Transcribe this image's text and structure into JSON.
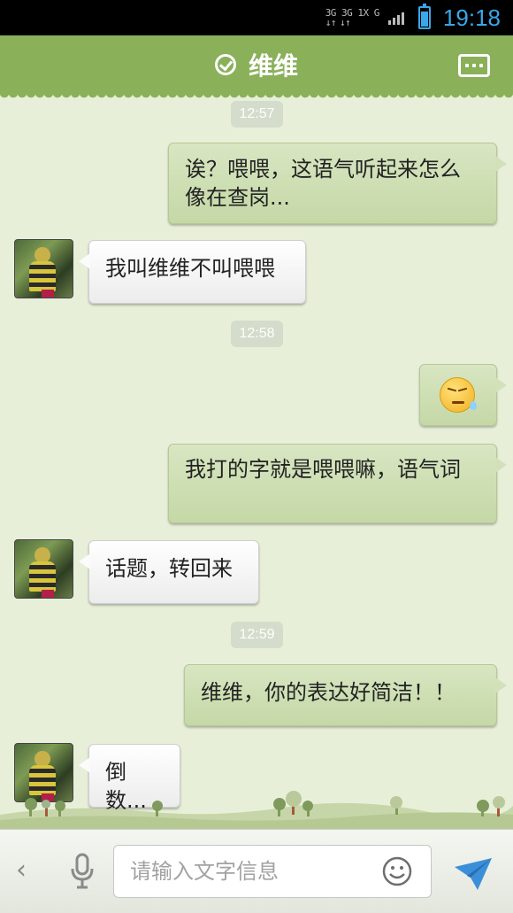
{
  "status_bar": {
    "net_top": "3G 3G 1X G",
    "time": "19:18"
  },
  "header": {
    "title": "维维",
    "verified_icon": "check-circle-icon",
    "more_icon": "more-dots-icon"
  },
  "messages": [
    {
      "type": "time",
      "text": "12:57"
    },
    {
      "type": "out",
      "text": "诶？喂喂，这语气听起来怎么像在查岗..."
    },
    {
      "type": "in",
      "text": "我叫维维不叫喂喂"
    },
    {
      "type": "time",
      "text": "12:58"
    },
    {
      "type": "out-emoji",
      "emoji": "sweat-squint-face"
    },
    {
      "type": "out",
      "text": "我打的字就是喂喂嘛，语气词"
    },
    {
      "type": "in",
      "text": "话题，转回来"
    },
    {
      "type": "time",
      "text": "12:59"
    },
    {
      "type": "out",
      "text": "维维，你的表达好简洁！！"
    },
    {
      "type": "in",
      "text": "倒数..."
    }
  ],
  "input_bar": {
    "placeholder": "请输入文字信息",
    "icons": [
      "chevron-left-icon",
      "microphone-icon",
      "smiley-icon",
      "send-icon"
    ]
  },
  "colors": {
    "header": "#8ab05a",
    "background": "#e8efd9",
    "outgoing_bubble": "#cfdfb5",
    "incoming_bubble": "#ffffff",
    "status_accent": "#3aa7e8"
  }
}
